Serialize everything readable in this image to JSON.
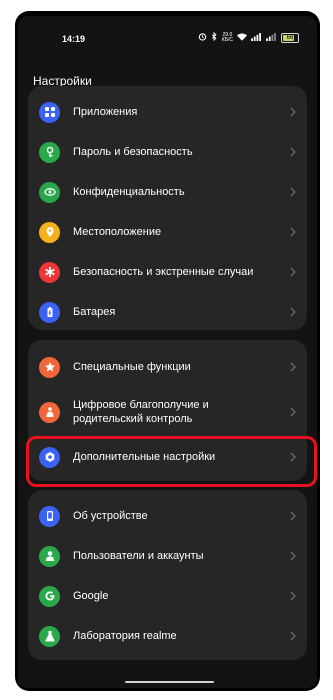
{
  "status_bar": {
    "time": "14:19",
    "speed_value": "29.0",
    "speed_unit": "КБ/С",
    "battery": "66"
  },
  "page": {
    "title": "Настройки"
  },
  "groups": [
    {
      "items": [
        {
          "label": "Приложения",
          "icon": "apps-icon",
          "color": "#3a63f5"
        },
        {
          "label": "Пароль и безопасность",
          "icon": "lock-icon",
          "color": "#2aa94b"
        },
        {
          "label": "Конфиденциальность",
          "icon": "privacy-icon",
          "color": "#27a74a"
        },
        {
          "label": "Местоположение",
          "icon": "location-icon",
          "color": "#f3b21b"
        },
        {
          "label": "Безопасность и экстренные случаи",
          "icon": "emergency-icon",
          "color": "#ee3636"
        },
        {
          "label": "Батарея",
          "icon": "battery-icon",
          "color": "#3a63f5"
        }
      ]
    },
    {
      "items": [
        {
          "label": "Специальные функции",
          "icon": "accessibility-icon",
          "color": "#f2663a"
        },
        {
          "label": "Цифровое благополучие и родительский контроль",
          "icon": "wellbeing-icon",
          "color": "#f2663a"
        },
        {
          "label": "Дополнительные настройки",
          "icon": "gear-icon",
          "color": "#3a63f5"
        }
      ]
    },
    {
      "items": [
        {
          "label": "Об устройстве",
          "icon": "phone-icon",
          "color": "#3a63f5"
        },
        {
          "label": "Пользователи и аккаунты",
          "icon": "user-icon",
          "color": "#2aa94b"
        },
        {
          "label": "Google",
          "icon": "google-icon",
          "color": "#2aa94b"
        },
        {
          "label": "Лаборатория realme",
          "icon": "flask-icon",
          "color": "#2aa94b"
        }
      ]
    }
  ],
  "highlight_color": "#e8111f"
}
